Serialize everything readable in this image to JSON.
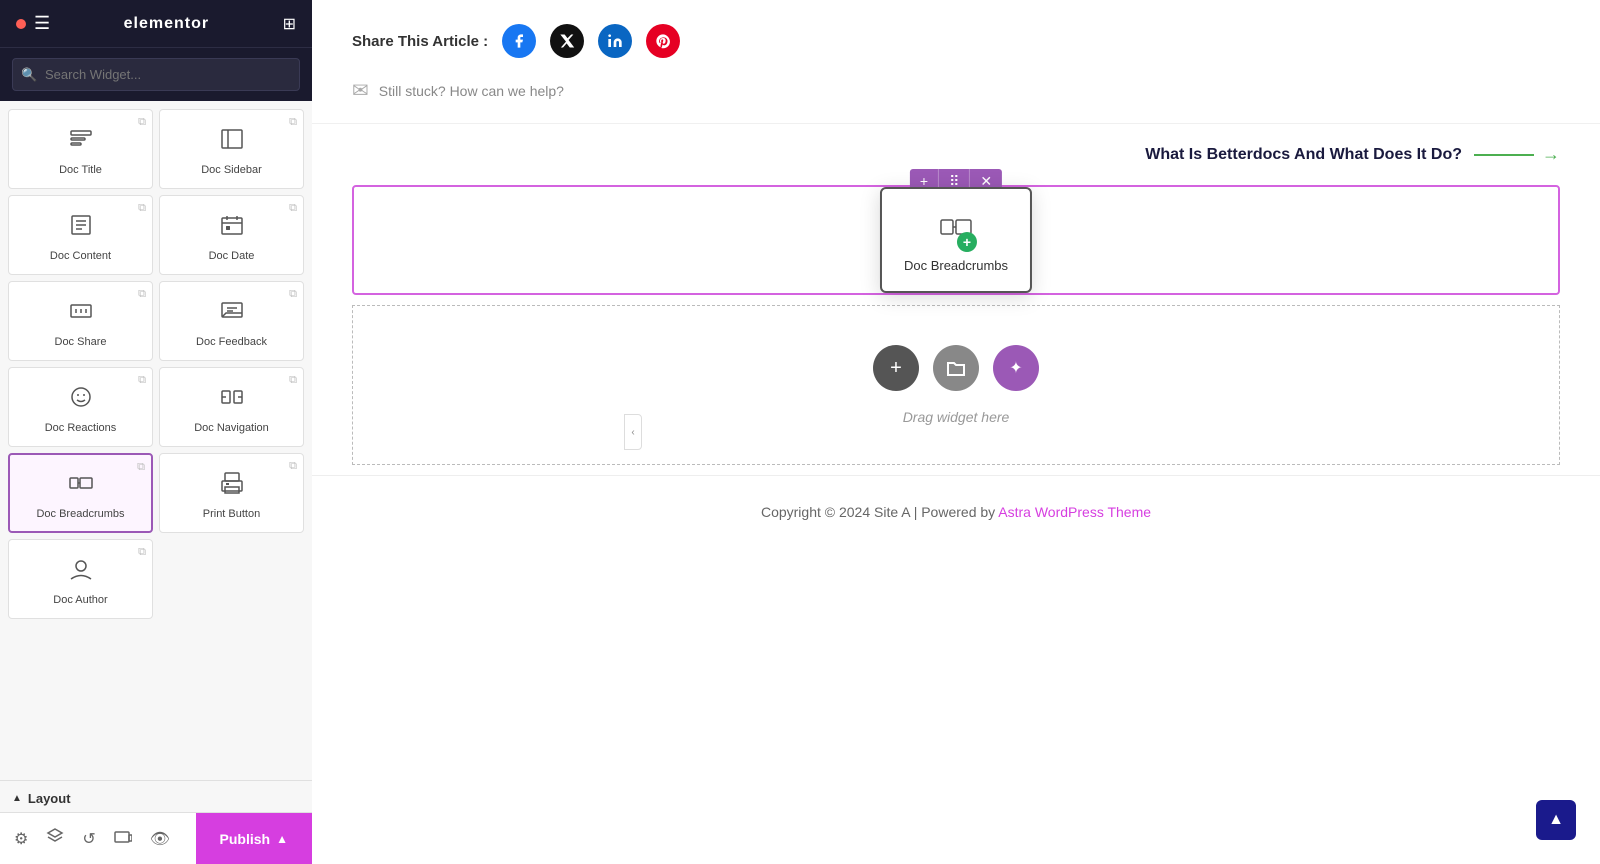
{
  "sidebar": {
    "title": "elementor",
    "search_placeholder": "Search Widget...",
    "widgets": [
      {
        "id": "doc-title",
        "label": "Doc Title",
        "icon": "doc-title-icon",
        "active": false
      },
      {
        "id": "doc-sidebar",
        "label": "Doc Sidebar",
        "icon": "doc-sidebar-icon",
        "active": false
      },
      {
        "id": "doc-content",
        "label": "Doc Content",
        "icon": "doc-content-icon",
        "active": false
      },
      {
        "id": "doc-date",
        "label": "Doc Date",
        "icon": "doc-date-icon",
        "active": false
      },
      {
        "id": "doc-share",
        "label": "Doc Share",
        "icon": "doc-share-icon",
        "active": false
      },
      {
        "id": "doc-feedback",
        "label": "Doc Feedback",
        "icon": "doc-feedback-icon",
        "active": false
      },
      {
        "id": "doc-reactions",
        "label": "Doc Reactions",
        "icon": "doc-reactions-icon",
        "active": false
      },
      {
        "id": "doc-navigation",
        "label": "Doc Navigation",
        "icon": "doc-navigation-icon",
        "active": false
      },
      {
        "id": "doc-breadcrumbs",
        "label": "Doc Breadcrumbs",
        "icon": "doc-breadcrumbs-icon",
        "active": true
      },
      {
        "id": "print-button",
        "label": "Print Button",
        "icon": "print-button-icon",
        "active": false
      },
      {
        "id": "doc-author",
        "label": "Doc Author",
        "icon": "doc-author-icon",
        "active": false
      }
    ],
    "layout_section": {
      "label": "Layout",
      "chevron": "▲"
    }
  },
  "toolbar": {
    "settings_icon": "⚙",
    "layers_icon": "⊕",
    "history_icon": "↺",
    "responsive_icon": "⊡",
    "preview_icon": "👁",
    "publish_label": "Publish",
    "expand_icon": "▲"
  },
  "canvas": {
    "share_label": "Share This Article :",
    "social_icons": [
      "Facebook",
      "X/Twitter",
      "LinkedIn",
      "Pinterest"
    ],
    "help_text": "Still stuck? How can we help?",
    "next_article_label": "What Is Betterdocs And What Does It Do?",
    "breadcrumb_controls": [
      "+",
      "⠿",
      "✕"
    ],
    "breadcrumb_widget_label": "Doc Breadcrumbs",
    "drop_hint": "Drag widget here",
    "footer_text": "Copyright © 2024 Site A | Powered by ",
    "footer_link_text": "Astra WordPress Theme",
    "scroll_top_icon": "▲"
  }
}
